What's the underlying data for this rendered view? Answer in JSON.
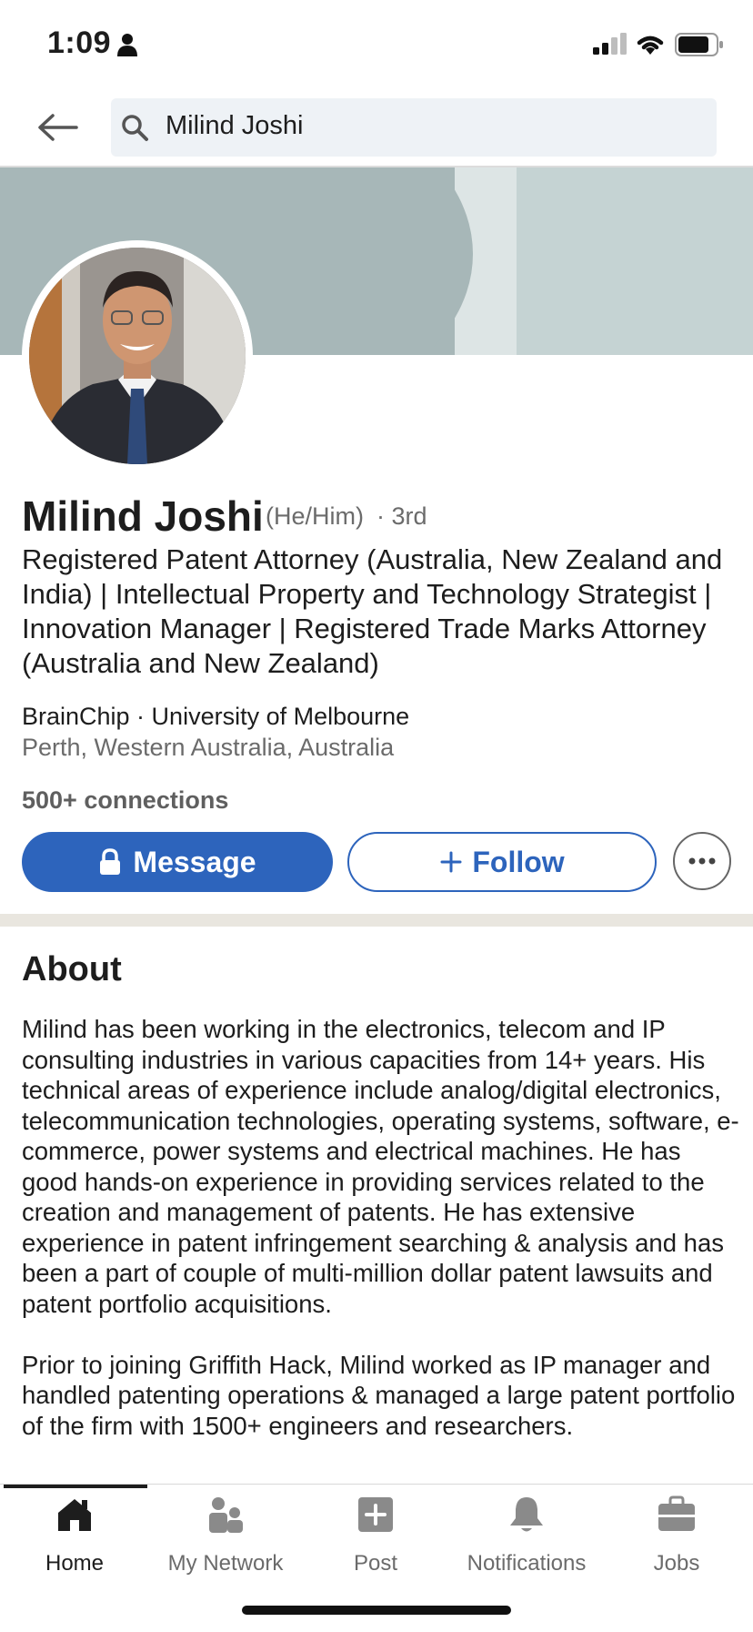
{
  "status_bar": {
    "time": "1:09"
  },
  "search": {
    "query": "Milind Joshi"
  },
  "profile": {
    "name": "Milind Joshi",
    "pronouns": "(He/Him)",
    "degree": "· 3rd",
    "headline": "Registered Patent Attorney (Australia, New Zealand and India) | Intellectual Property and Technology Strategist | Innovation Manager | Registered Trade Marks Attorney (Australia and New Zealand)",
    "company": "BrainChip · University of Melbourne",
    "location": "Perth, Western Australia, Australia",
    "connections": "500+ connections"
  },
  "actions": {
    "message_label": "Message",
    "follow_label": "Follow"
  },
  "about": {
    "title": "About",
    "text": "Milind has been working in the electronics, telecom and IP consulting industries in various capacities from 14+ years. His technical areas of experience include analog/digital electronics, telecommunication technologies, operating systems, software, e-commerce, power systems and electrical machines. He has good hands-on experience in providing services related to the creation and management of patents. He has extensive experience in patent infringement searching & analysis and has been a part of couple of multi-million dollar patent lawsuits and patent portfolio acquisitions.\n\nPrior to joining Griffith Hack, Milind worked as IP manager and handled patenting operations & managed a large patent portfolio of the firm with 1500+ engineers and researchers."
  },
  "nav": {
    "items": [
      {
        "label": "Home",
        "icon": "home-icon",
        "active": true
      },
      {
        "label": "My Network",
        "icon": "network-icon",
        "active": false
      },
      {
        "label": "Post",
        "icon": "post-icon",
        "active": false
      },
      {
        "label": "Notifications",
        "icon": "bell-icon",
        "active": false
      },
      {
        "label": "Jobs",
        "icon": "briefcase-icon",
        "active": false
      }
    ]
  },
  "colors": {
    "brand_blue": "#2d64bc",
    "banner": "#a7b7b8",
    "section_gap": "#e9e6df"
  }
}
